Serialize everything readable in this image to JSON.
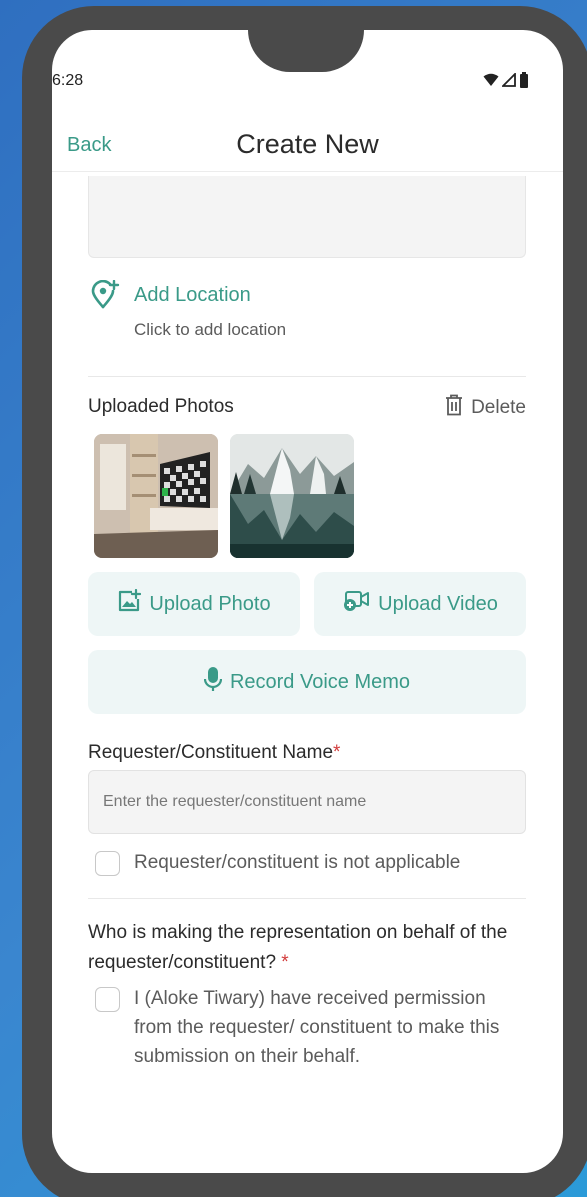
{
  "status_bar": {
    "time": "6:28"
  },
  "header": {
    "back_label": "Back",
    "title": "Create New"
  },
  "location": {
    "add_label": "Add Location",
    "subtitle": "Click to add location"
  },
  "photos": {
    "label": "Uploaded Photos",
    "delete_label": "Delete"
  },
  "actions": {
    "upload_photo": "Upload Photo",
    "upload_video": "Upload Video",
    "record_memo": "Record Voice Memo"
  },
  "requester": {
    "label": "Requester/Constituent Name",
    "required_mark": "*",
    "placeholder": "Enter the requester/constituent name",
    "value": "",
    "na_label": "Requester/constituent is not applicable",
    "na_checked": false
  },
  "representation": {
    "question": "Who is making the representation on behalf of the requester/constituent?",
    "required_mark": "*",
    "permission_text": "I (Aloke Tiwary) have received permission from the requester/ constituent to make this submission on their behalf.",
    "permission_checked": false
  },
  "colors": {
    "accent": "#3a9a88",
    "required": "#d23b3b",
    "button_bg": "#eef6f6"
  },
  "icons": {
    "location": "add-location-pin-icon",
    "delete": "trash-icon",
    "upload_photo": "add-image-icon",
    "upload_video": "add-video-icon",
    "record": "microphone-icon"
  }
}
